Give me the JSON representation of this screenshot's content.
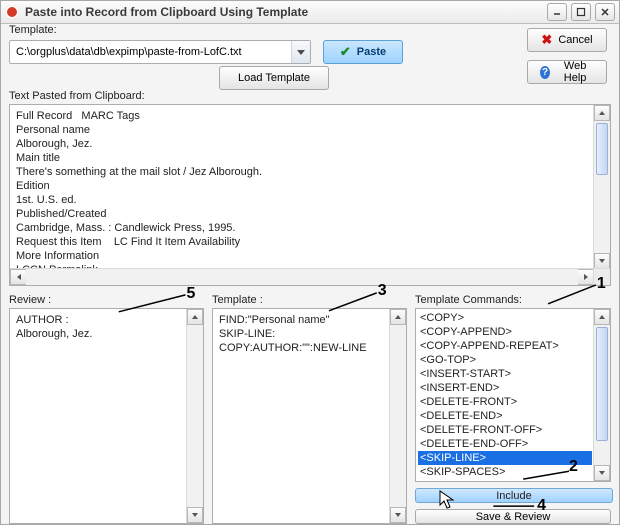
{
  "window": {
    "title": "Paste into Record from Clipboard Using Template"
  },
  "toolbar": {
    "template_label": "Template:",
    "template_path": "C:\\orgplus\\data\\db\\expimp\\paste-from-LofC.txt",
    "paste_label": "Paste",
    "load_template_label": "Load Template",
    "cancel_label": "Cancel",
    "web_help_label": "Web Help"
  },
  "clipboard": {
    "label": "Text Pasted from Clipboard:",
    "text": "Full Record   MARC Tags\nPersonal name\nAlborough, Jez.\nMain title\nThere's something at the mail slot / Jez Alborough.\nEdition\n1st. U.S. ed.\nPublished/Created\nCambridge, Mass. : Candlewick Press, 1995.\nRequest this Item    LC Find It Item Availability\nMore Information\nLCCN Permalink"
  },
  "review": {
    "label": "Review :",
    "lines": [
      "AUTHOR :",
      "  Alborough, Jez."
    ]
  },
  "template": {
    "label": "Template :",
    "lines": [
      "FIND:\"Personal name\"",
      "SKIP-LINE:",
      "COPY:AUTHOR:\"\":NEW-LINE"
    ]
  },
  "commands": {
    "label": "Template Commands:",
    "items": [
      "<COPY>",
      "<COPY-APPEND>",
      "<COPY-APPEND-REPEAT>",
      "<GO-TOP>",
      "<INSERT-START>",
      "<INSERT-END>",
      "<DELETE-FRONT>",
      "<DELETE-END>",
      "<DELETE-FRONT-OFF>",
      "<DELETE-END-OFF>",
      "<SKIP-LINE>",
      "<SKIP-SPACES>"
    ],
    "selected_index": 10,
    "include_label": "Include",
    "save_review_label": "Save & Review"
  },
  "annotations": {
    "n1": "1",
    "n2": "2",
    "n3": "3",
    "n4": "4",
    "n5": "5"
  }
}
